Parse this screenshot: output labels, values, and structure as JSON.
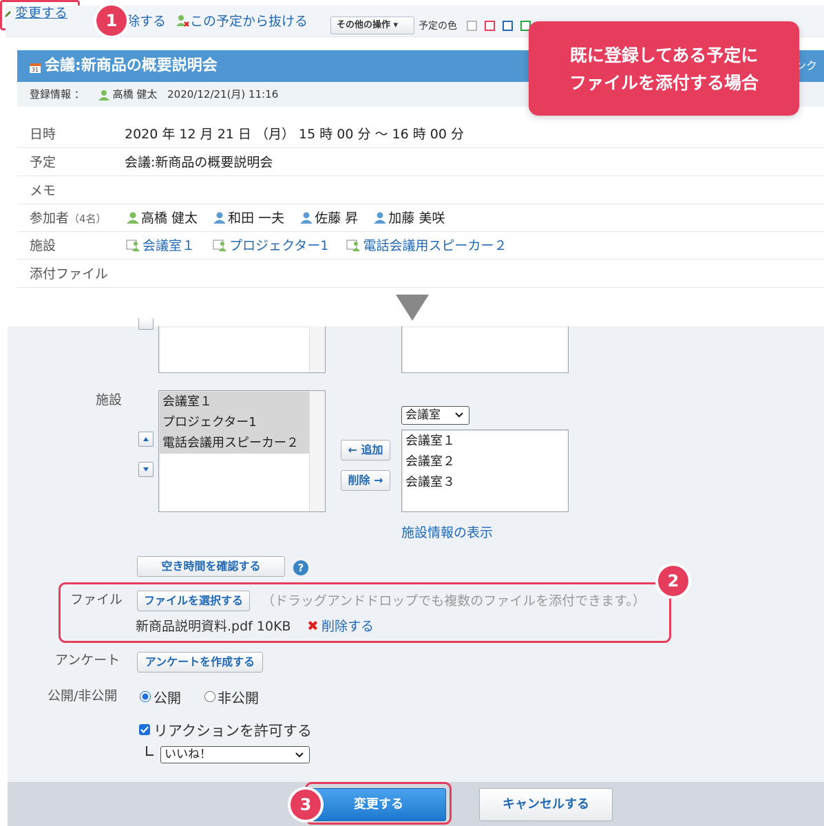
{
  "toolbar": {
    "edit_label": "変更する",
    "delete_partial": "除する",
    "leave_label": "この予定から抜ける",
    "other_ops_label": "その他の操作 ▾",
    "color_label": "予定の色",
    "colors": [
      "#e63d5c",
      "#2169b4",
      "#27a844",
      "#e8913a"
    ]
  },
  "badges": {
    "step1": "1",
    "step2": "2",
    "step3": "3"
  },
  "callout": {
    "line1": "既に登録してある予定に",
    "line2": "ファイルを添付する場合"
  },
  "event": {
    "title": "会議:新商品の概要説明会",
    "title_link_partial": "ンク",
    "reg_label": "登録情報 ：",
    "reg_user": "高橋 健太",
    "reg_datetime": "2020/12/21(月) 11:16"
  },
  "details": {
    "date_label": "日時",
    "date_value": "2020 年 12 月 21 日 （月） 15 時 00 分 〜 16 時 00 分",
    "plan_label": "予定",
    "plan_value": "会議:新商品の概要説明会",
    "memo_label": "メモ",
    "participants_label": "参加者",
    "participants_count": "（4名）",
    "participants": [
      "高橋 健太",
      "和田 一夫",
      "佐藤 昇",
      "加藤 美咲"
    ],
    "facility_label": "施設",
    "facilities": [
      "会議室１",
      "プロジェクター1",
      "電話会議用スピーカー２"
    ],
    "attach_label": "添付ファイル"
  },
  "form": {
    "facility_label": "施設",
    "selected_facilities": [
      "会議室１",
      "プロジェクター1",
      "電話会議用スピーカー２"
    ],
    "add_btn": "← 追加",
    "remove_btn": "削除 →",
    "category_select": "会議室",
    "candidate_facilities": [
      "会議室１",
      "会議室２",
      "会議室３"
    ],
    "facility_info_link": "施設情報の表示",
    "check_free_btn": "空き時間を確認する",
    "help": "?",
    "file_label": "ファイル",
    "select_file_btn": "ファイルを選択する",
    "drag_hint": "（ドラッグアンドドロップでも複数のファイルを添付できます。）",
    "file_name": "新商品説明資料.pdf 10KB",
    "delete_x": "✖",
    "delete_link": "削除する",
    "survey_label": "アンケート",
    "create_survey_btn": "アンケートを作成する",
    "visibility_label": "公開/非公開",
    "public_label": "公開",
    "private_label": "非公開",
    "reaction_label": "リアクションを許可する",
    "reaction_select": "いいね！",
    "submit_btn": "変更する",
    "cancel_btn": "キャンセルする"
  }
}
